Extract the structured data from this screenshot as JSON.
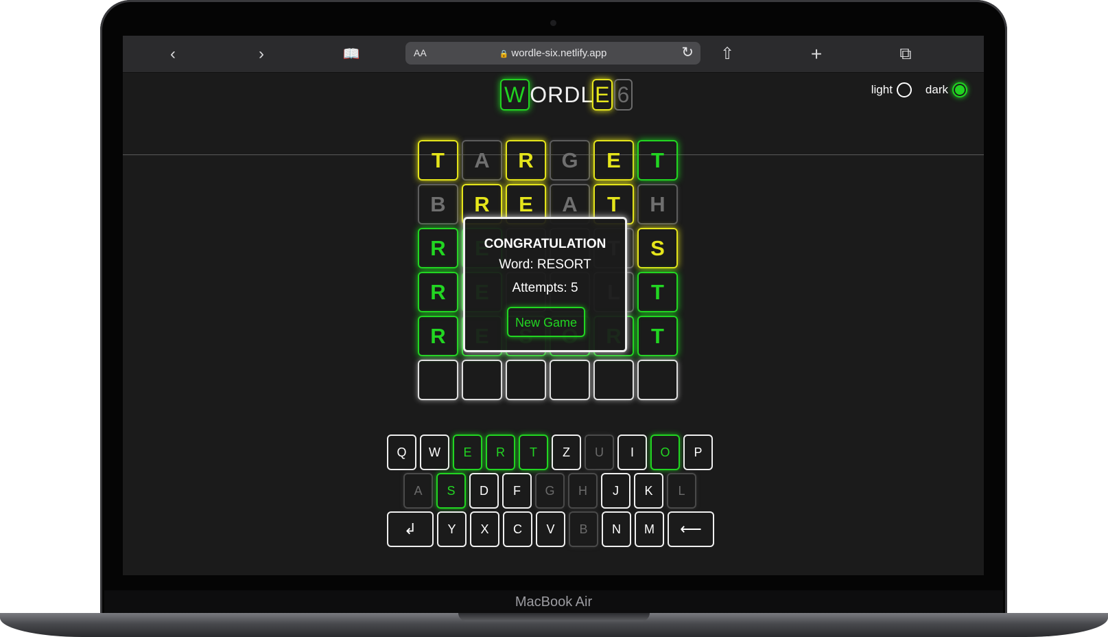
{
  "device": {
    "label": "MacBook Air"
  },
  "browser": {
    "aa_label": "AA",
    "url": "wordle-six.netlify.app",
    "lock_icon": "🔒",
    "icons": {
      "back": "‹",
      "forward": "›",
      "bookmarks": "📖",
      "reload": "↻",
      "share": "⇧",
      "new_tab": "+",
      "tabs": "⧉"
    }
  },
  "app": {
    "logo": {
      "w": "W",
      "middle": "ORDL",
      "e": "E",
      "six": "6"
    },
    "theme": {
      "light_label": "light",
      "dark_label": "dark",
      "selected": "dark"
    }
  },
  "board": [
    [
      {
        "l": "T",
        "s": "y"
      },
      {
        "l": "A",
        "s": "x"
      },
      {
        "l": "R",
        "s": "y"
      },
      {
        "l": "G",
        "s": "x"
      },
      {
        "l": "E",
        "s": "y"
      },
      {
        "l": "T",
        "s": "g"
      }
    ],
    [
      {
        "l": "B",
        "s": "x"
      },
      {
        "l": "R",
        "s": "y"
      },
      {
        "l": "E",
        "s": "y"
      },
      {
        "l": "A",
        "s": "x"
      },
      {
        "l": "T",
        "s": "y"
      },
      {
        "l": "H",
        "s": "x"
      }
    ],
    [
      {
        "l": "R",
        "s": "g"
      },
      {
        "l": "E",
        "s": "g"
      },
      {
        "l": "",
        "s": "x"
      },
      {
        "l": "",
        "s": "x"
      },
      {
        "l": "T",
        "s": "x"
      },
      {
        "l": "S",
        "s": "y"
      }
    ],
    [
      {
        "l": "R",
        "s": "g"
      },
      {
        "l": "E",
        "s": "g"
      },
      {
        "l": "",
        "s": "x"
      },
      {
        "l": "",
        "s": "x"
      },
      {
        "l": "L",
        "s": "x"
      },
      {
        "l": "T",
        "s": "g"
      }
    ],
    [
      {
        "l": "R",
        "s": "g"
      },
      {
        "l": "E",
        "s": "g"
      },
      {
        "l": "S",
        "s": "g"
      },
      {
        "l": "O",
        "s": "g"
      },
      {
        "l": "R",
        "s": "g"
      },
      {
        "l": "T",
        "s": "g"
      }
    ],
    [
      {
        "l": "",
        "s": "e"
      },
      {
        "l": "",
        "s": "e"
      },
      {
        "l": "",
        "s": "e"
      },
      {
        "l": "",
        "s": "e"
      },
      {
        "l": "",
        "s": "e"
      },
      {
        "l": "",
        "s": "e"
      }
    ]
  ],
  "modal": {
    "title": "CONGRATULATION",
    "word_text": "Word: RESORT",
    "attempts_text": "Attempts: 5",
    "button_label": "New Game"
  },
  "keyboard": [
    [
      {
        "k": "Q",
        "s": ""
      },
      {
        "k": "W",
        "s": ""
      },
      {
        "k": "E",
        "s": "g"
      },
      {
        "k": "R",
        "s": "g"
      },
      {
        "k": "T",
        "s": "g"
      },
      {
        "k": "Z",
        "s": ""
      },
      {
        "k": "U",
        "s": "x"
      },
      {
        "k": "I",
        "s": ""
      },
      {
        "k": "O",
        "s": "g"
      },
      {
        "k": "P",
        "s": ""
      }
    ],
    [
      {
        "k": "A",
        "s": "x"
      },
      {
        "k": "S",
        "s": "g"
      },
      {
        "k": "D",
        "s": ""
      },
      {
        "k": "F",
        "s": ""
      },
      {
        "k": "G",
        "s": "x"
      },
      {
        "k": "H",
        "s": "x"
      },
      {
        "k": "J",
        "s": ""
      },
      {
        "k": "K",
        "s": ""
      },
      {
        "k": "L",
        "s": "x"
      }
    ],
    [
      {
        "k": "↲",
        "s": "",
        "wide": true,
        "name": "enter-key"
      },
      {
        "k": "Y",
        "s": ""
      },
      {
        "k": "X",
        "s": ""
      },
      {
        "k": "C",
        "s": ""
      },
      {
        "k": "V",
        "s": ""
      },
      {
        "k": "B",
        "s": "x"
      },
      {
        "k": "N",
        "s": ""
      },
      {
        "k": "M",
        "s": ""
      },
      {
        "k": "⟵",
        "s": "",
        "wide": true,
        "name": "backspace-key"
      }
    ]
  ],
  "colors": {
    "green": "#22d622",
    "yellow": "#e5e51b",
    "absent": "#5d5d5d",
    "background": "#1b1b1b"
  }
}
